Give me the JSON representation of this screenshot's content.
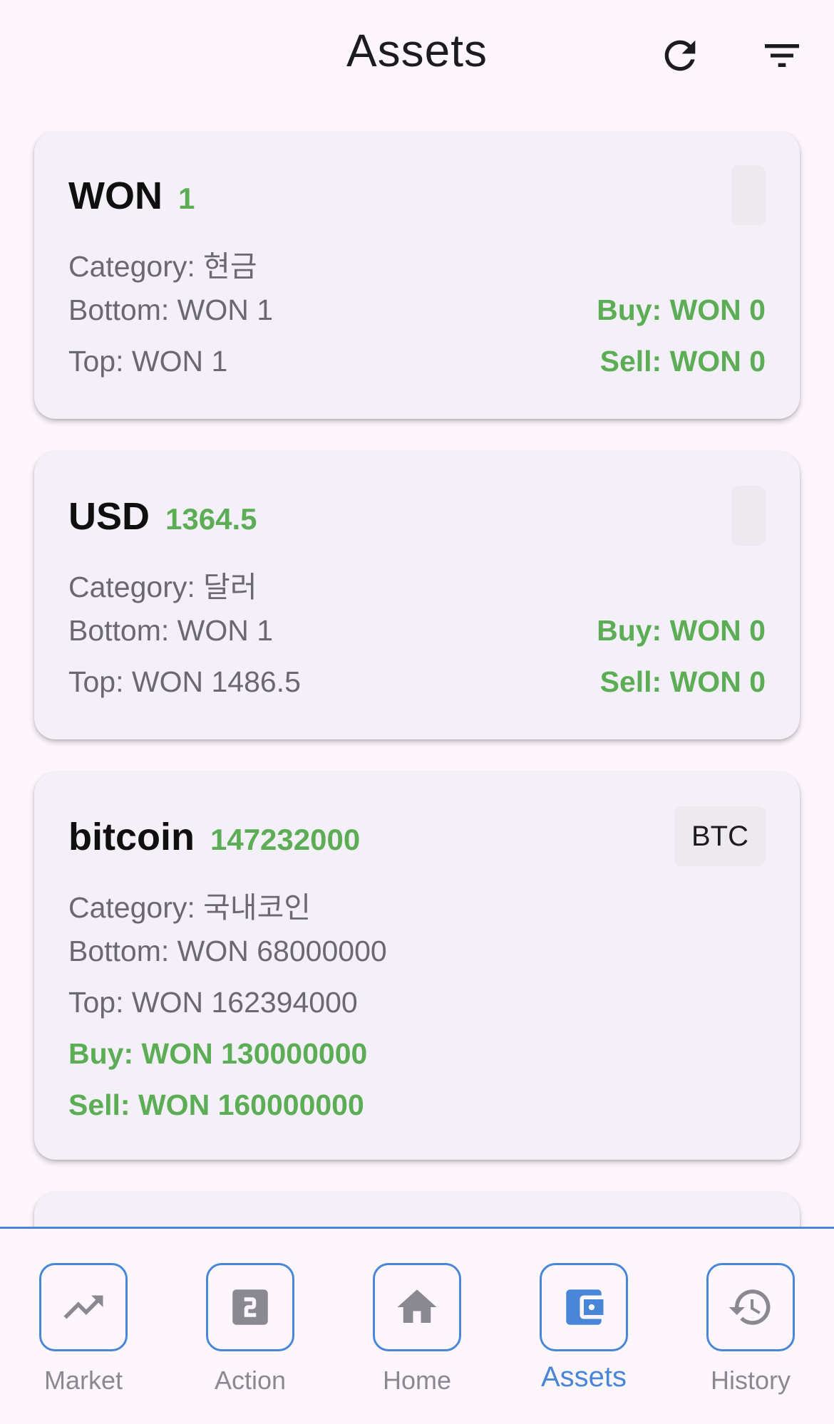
{
  "header": {
    "title": "Assets",
    "refresh_icon": "refresh-icon",
    "filter_icon": "filter-icon"
  },
  "assets": [
    {
      "name": "WON",
      "price": "1",
      "chip": "",
      "category": "Category: 현금",
      "bottom": "Bottom: WON 1",
      "top": "Top: WON 1",
      "buy": "Buy: WON 0",
      "sell": "Sell: WON 0"
    },
    {
      "name": "USD",
      "price": "1364.5",
      "chip": "",
      "category": "Category: 달러",
      "bottom": "Bottom: WON 1",
      "top": "Top: WON 1486.5",
      "buy": "Buy: WON 0",
      "sell": "Sell: WON 0"
    },
    {
      "name": "bitcoin",
      "price": "147232000",
      "chip": "BTC",
      "category": "Category: 국내코인",
      "bottom": "Bottom: WON 68000000",
      "top": "Top: WON 162394000",
      "buy": "Buy: WON 130000000",
      "sell": "Sell: WON 160000000"
    }
  ],
  "nav": {
    "items": [
      {
        "label": "Market",
        "icon": "trending-up-icon"
      },
      {
        "label": "Action",
        "icon": "counter-2-icon"
      },
      {
        "label": "Home",
        "icon": "home-icon"
      },
      {
        "label": "Assets",
        "icon": "wallet-icon"
      },
      {
        "label": "History",
        "icon": "history-icon"
      }
    ],
    "active": "Assets"
  },
  "colors": {
    "accent": "#4a86d8",
    "positive": "#5cad55",
    "card_bg": "#f3f1f7",
    "page_bg": "#fdf7fd"
  }
}
